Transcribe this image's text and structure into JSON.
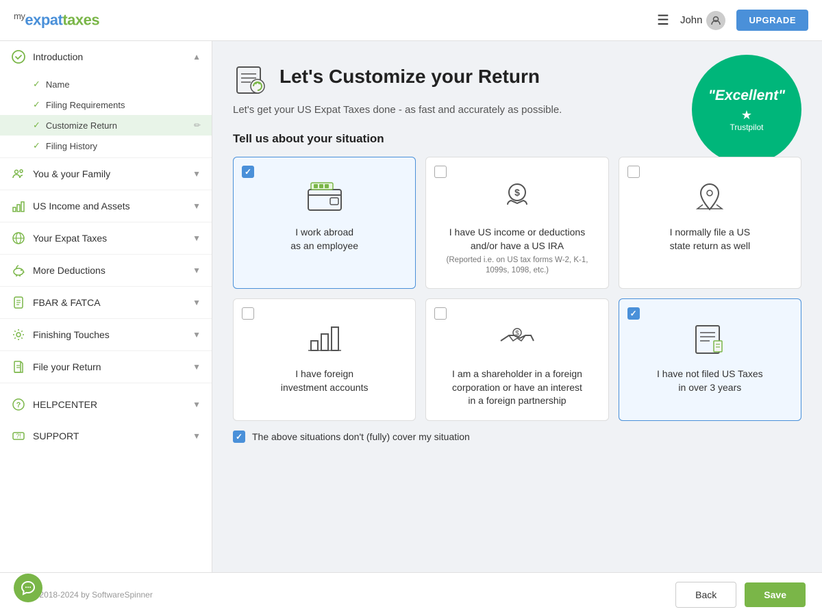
{
  "header": {
    "logo_my": "my",
    "logo_expat": "expat",
    "logo_taxes": "taxes",
    "username": "John",
    "upgrade_label": "UPGRADE"
  },
  "sidebar": {
    "sections": [
      {
        "id": "introduction",
        "label": "Introduction",
        "icon": "circle-check-icon",
        "expanded": true,
        "children": [
          {
            "id": "name",
            "label": "Name",
            "checked": true
          },
          {
            "id": "filing-requirements",
            "label": "Filing Requirements",
            "checked": true
          },
          {
            "id": "customize-return",
            "label": "Customize Return",
            "checked": true,
            "active": true,
            "editable": true
          },
          {
            "id": "filing-history",
            "label": "Filing History",
            "checked": true
          }
        ]
      },
      {
        "id": "you-family",
        "label": "You & your Family",
        "icon": "family-icon",
        "expanded": false,
        "children": []
      },
      {
        "id": "us-income",
        "label": "US Income and Assets",
        "icon": "chart-icon",
        "expanded": false,
        "children": []
      },
      {
        "id": "expat-taxes",
        "label": "Your Expat Taxes",
        "icon": "globe-icon",
        "expanded": false,
        "children": []
      },
      {
        "id": "more-deductions",
        "label": "More Deductions",
        "icon": "piggy-icon",
        "expanded": false,
        "children": []
      },
      {
        "id": "fbar-fatca",
        "label": "FBAR & FATCA",
        "icon": "document-icon",
        "expanded": false,
        "children": []
      },
      {
        "id": "finishing-touches",
        "label": "Finishing Touches",
        "icon": "settings-icon",
        "expanded": false,
        "children": []
      },
      {
        "id": "file-return",
        "label": "File your Return",
        "icon": "file-icon",
        "expanded": false,
        "children": []
      }
    ],
    "bottom_sections": [
      {
        "id": "helpcenter",
        "label": "HELPCENTER",
        "icon": "help-icon"
      },
      {
        "id": "support",
        "label": "SUPPORT",
        "icon": "support-icon"
      }
    ]
  },
  "page": {
    "title": "Let's Customize your Return",
    "subtitle": "Let's get your US Expat Taxes done - as fast and accurately as possible.",
    "section_title": "Tell us about your situation",
    "trustpilot": {
      "rating": "\"Excellent\"",
      "label": "Trustpilot"
    },
    "options": [
      {
        "id": "work-abroad",
        "label": "I work abroad\nas an employee",
        "sublabel": "",
        "selected": true,
        "icon": "wallet-icon"
      },
      {
        "id": "us-income",
        "label": "I have US income or deductions\nand/or have a US IRA",
        "sublabel": "(Reported i.e. on US tax forms W-2, K-1,\n1099s, 1098, etc.)",
        "selected": false,
        "icon": "money-hand-icon"
      },
      {
        "id": "state-return",
        "label": "I normally file a US\nstate return as well",
        "sublabel": "",
        "selected": false,
        "icon": "map-pin-icon"
      },
      {
        "id": "foreign-accounts",
        "label": "I have foreign\ninvestment accounts",
        "sublabel": "",
        "selected": false,
        "icon": "bar-chart-icon"
      },
      {
        "id": "shareholder",
        "label": "I am a shareholder in a foreign\ncorporation or have an interest\nin a foreign partnership",
        "sublabel": "",
        "selected": false,
        "icon": "handshake-icon"
      },
      {
        "id": "not-filed",
        "label": "I have not filed US Taxes\nin over 3 years",
        "sublabel": "",
        "selected": true,
        "icon": "checklist-icon"
      }
    ],
    "bottom_checkbox": {
      "checked": true,
      "label": "The above situations don't (fully) cover my situation"
    }
  },
  "footer": {
    "copyright": "2018-2024 by SoftwareSpinner",
    "back_label": "Back",
    "save_label": "Save"
  }
}
